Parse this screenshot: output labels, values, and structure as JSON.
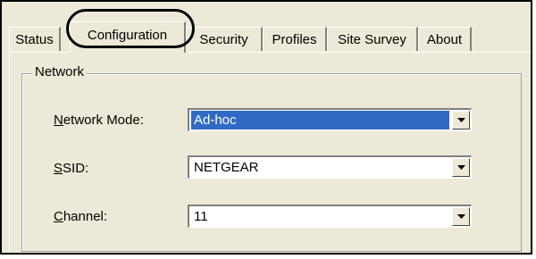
{
  "tabs": [
    {
      "label": "Status"
    },
    {
      "label": "Configuration",
      "active": true
    },
    {
      "label": "Security"
    },
    {
      "label": "Profiles"
    },
    {
      "label": "Site Survey"
    },
    {
      "label": "About"
    }
  ],
  "group": {
    "legend": "Network"
  },
  "fields": [
    {
      "label_accel": "N",
      "label_rest": "etwork Mode:",
      "value": "Ad-hoc",
      "selected": true
    },
    {
      "label_accel": "S",
      "label_rest": "SID:",
      "value": "NETGEAR"
    },
    {
      "label_accel": "C",
      "label_rest": "hannel:",
      "value": "11"
    }
  ],
  "icons": {
    "dropdown": "chevron-down-icon"
  },
  "colors": {
    "selection": "#316ac5",
    "dialog_bg": "#ece9d8"
  }
}
